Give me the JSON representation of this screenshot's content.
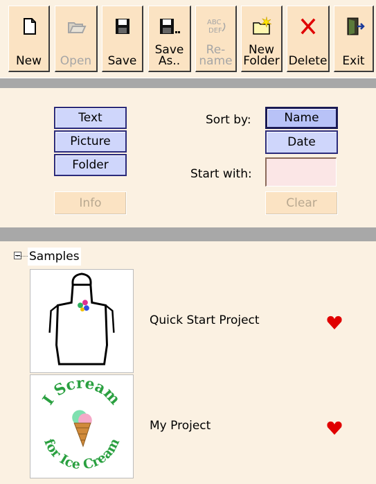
{
  "toolbar": {
    "buttons": [
      {
        "id": "new",
        "label": "New",
        "icon": "new-document-icon",
        "enabled": true
      },
      {
        "id": "open",
        "label": "Open",
        "icon": "open-folder-icon",
        "enabled": false
      },
      {
        "id": "save",
        "label": "Save",
        "icon": "floppy-disk-icon",
        "enabled": true
      },
      {
        "id": "save-as",
        "label": "Save\nAs..",
        "icon": "floppy-disk-ellipsis-icon",
        "enabled": true
      },
      {
        "id": "rename",
        "label": "Re-\nname",
        "icon": "rename-abc-def-icon",
        "enabled": false
      },
      {
        "id": "new-folder",
        "label": "New\nFolder",
        "icon": "new-folder-icon",
        "enabled": true
      },
      {
        "id": "delete",
        "label": "Delete",
        "icon": "red-x-icon",
        "enabled": true
      },
      {
        "id": "exit",
        "label": "Exit",
        "icon": "exit-door-icon",
        "enabled": true
      }
    ]
  },
  "filters": {
    "type_buttons": [
      "Text",
      "Picture",
      "Folder"
    ],
    "info": "Info",
    "sort_by_label": "Sort by:",
    "sort_options": [
      "Name",
      "Date"
    ],
    "sort_selected": "Name",
    "start_with_label": "Start with:",
    "start_with_value": "",
    "clear": "Clear"
  },
  "tree": {
    "root": "Samples",
    "items": [
      {
        "name": "Quick Start Project",
        "thumbnail": "apron-icon",
        "favorite": true
      },
      {
        "name": "My Project",
        "thumbnail": "i-scream-ice-cream-logo",
        "favorite": true
      }
    ]
  },
  "colors": {
    "heart": "#e00000",
    "delete_x": "#e00000"
  }
}
